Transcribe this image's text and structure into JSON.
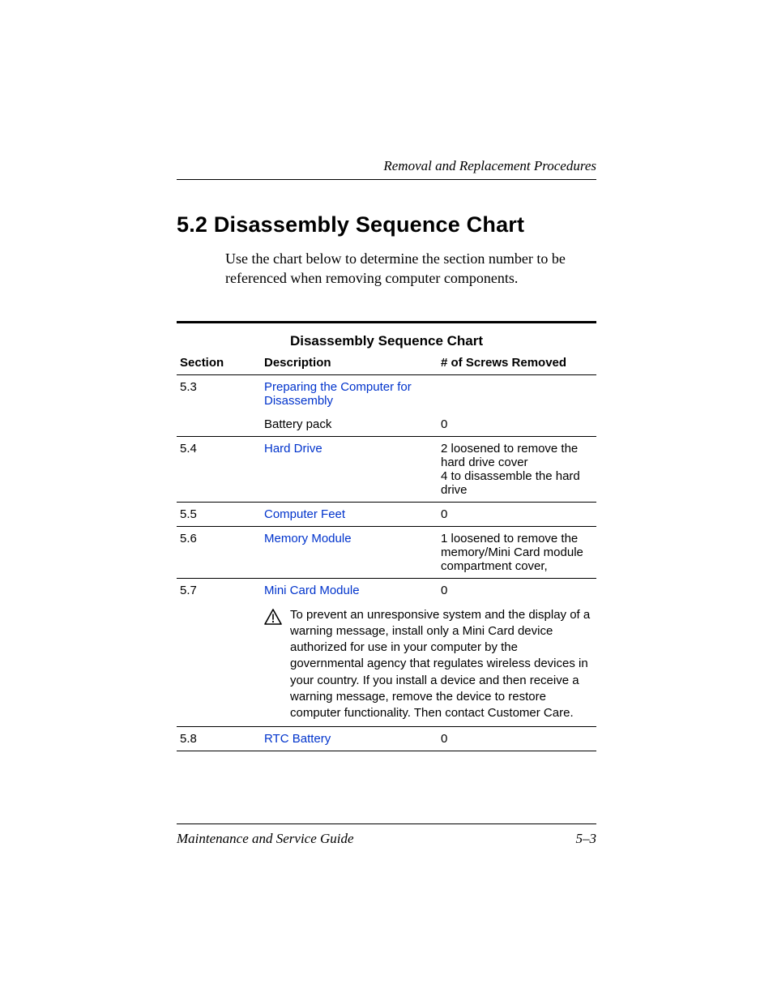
{
  "header": {
    "running_head": "Removal and Replacement Procedures"
  },
  "title": "5.2 Disassembly Sequence Chart",
  "intro": "Use the chart below to determine the section number to be referenced when removing computer components.",
  "table": {
    "title": "Disassembly Sequence Chart",
    "columns": {
      "section": "Section",
      "description": "Description",
      "screws": "# of Screws Removed"
    },
    "rows": {
      "r53": {
        "section": "5.3",
        "link": "Preparing the Computer for Disassembly",
        "sub_desc": "Battery pack",
        "sub_screws": "0"
      },
      "r54": {
        "section": "5.4",
        "link": "Hard Drive",
        "screws_line1": "2 loosened to remove the hard drive cover",
        "screws_line2": "4 to disassemble the hard drive"
      },
      "r55": {
        "section": "5.5",
        "link": "Computer Feet",
        "screws": "0"
      },
      "r56": {
        "section": "5.6",
        "link": "Memory Module",
        "screws": "1 loosened to remove the memory/Mini Card module compartment cover,"
      },
      "r57": {
        "section": "5.7",
        "link": "Mini Card Module",
        "screws": "0",
        "caution": "To prevent an unresponsive system and the display of a warning message, install only a Mini Card device authorized for use in your computer by the governmental agency that regulates wireless devices in your country. If you install a device and then receive a warning message, remove the device to restore computer functionality. Then contact Customer Care."
      },
      "r58": {
        "section": "5.8",
        "link": "RTC Battery",
        "screws": "0"
      }
    }
  },
  "footer": {
    "left": "Maintenance and Service Guide",
    "right": "5–3"
  }
}
